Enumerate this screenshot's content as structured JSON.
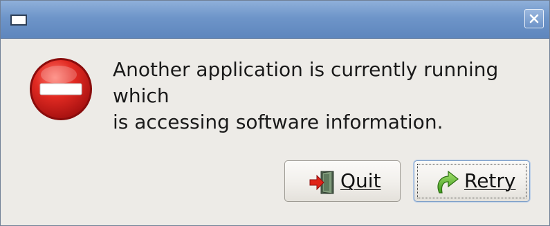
{
  "dialog": {
    "message_line1": "Another application is currently running which",
    "message_line2": "is accessing software information."
  },
  "titlebar": {
    "window_menu_icon": "window-menu-icon",
    "close_icon": "close-icon"
  },
  "buttons": {
    "quit": {
      "mnemonic": "Q",
      "rest": "uit",
      "icon": "exit-door-icon"
    },
    "retry": {
      "mnemonic": "R",
      "rest": "etry",
      "icon": "green-refresh-arrow-icon"
    }
  },
  "colors": {
    "titlebar": "#6e95c9",
    "dialog_bg": "#edebe7",
    "error_red": "#d81d1d"
  }
}
